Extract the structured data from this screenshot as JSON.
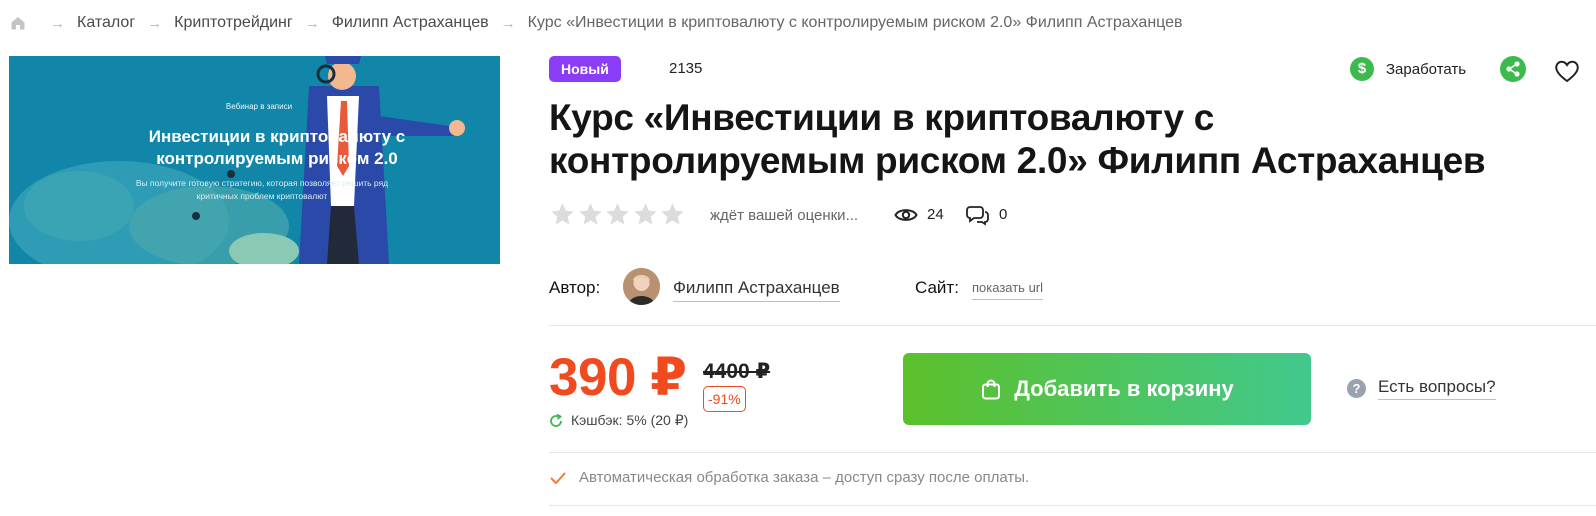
{
  "breadcrumb": {
    "home_icon": "home-icon",
    "items": [
      "Каталог",
      "Криптотрейдинг",
      "Филипп Астраханцев",
      "Курс «Инвестиции в криптовалюту с контролируемым риском 2.0» Филипп Астраханцев"
    ]
  },
  "hero": {
    "kicker": "Вебинар в записи",
    "title": "Инвестиции в криптовалюту с контролируемым риском 2.0",
    "subtitle": "Вы получите готовую стратегию, которая позволяет решить ряд критичных проблем криптовалют"
  },
  "product": {
    "badge": "Новый",
    "id": "2135",
    "title": "Курс «Инвестиции в криптовалюту с контролируемым риском 2.0» Филипп Астраханцев",
    "rating": {
      "value": 0,
      "max": 5,
      "text": "ждёт вашей оценки..."
    },
    "views": "24",
    "comments": "0"
  },
  "actions": {
    "earn_label": "Заработать",
    "earn_icon": "dollar-coin-icon",
    "share_icon": "share-icon",
    "favorite_icon": "heart-icon"
  },
  "author": {
    "label": "Автор:",
    "name": "Филипп Астраханцев",
    "site_label": "Сайт:",
    "site_link": "показать url"
  },
  "pricing": {
    "price": "390 ₽",
    "old_price": "4400 ₽",
    "discount": "-91%",
    "cashback": "Кэшбэк: 5% (20 ₽)"
  },
  "cart": {
    "button_label": "Добавить в корзину"
  },
  "help": {
    "icon_char": "?",
    "label": "Есть вопросы?"
  },
  "notice": {
    "text": "Автоматическая обработка заказа – доступ сразу после оплаты."
  },
  "colors": {
    "accent_green": "#3dba4e",
    "badge_purple": "#8b3cf7",
    "price_red": "#f04a1e",
    "hero_blue": "#1186a8"
  }
}
